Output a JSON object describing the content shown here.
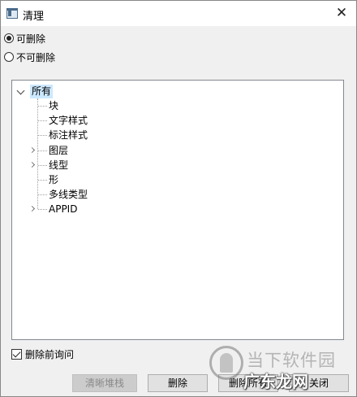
{
  "window": {
    "title": "清理",
    "close_glyph": "✕"
  },
  "options": {
    "purgeable": "可删除",
    "non_purgeable": "不可删除",
    "selected": "purgeable"
  },
  "tree": {
    "root": "所有",
    "items": [
      {
        "label": "块",
        "expandable": false
      },
      {
        "label": "文字样式",
        "expandable": false
      },
      {
        "label": "标注样式",
        "expandable": false
      },
      {
        "label": "图层",
        "expandable": true
      },
      {
        "label": "线型",
        "expandable": true
      },
      {
        "label": "形",
        "expandable": false
      },
      {
        "label": "多线类型",
        "expandable": false
      },
      {
        "label": "APPID",
        "expandable": true
      }
    ]
  },
  "confirm_checkbox": {
    "label": "删除前询问",
    "checked": true
  },
  "buttons": {
    "clean_stack": "清晰堆栈",
    "delete": "删除",
    "delete_all": "删除所有",
    "close": "关闭"
  },
  "watermark": {
    "line1": "当下软件园",
    "line2": "广东龙网"
  },
  "icons": {
    "app": "window-app-icon",
    "close": "close-icon",
    "expand": "chevron-down-icon",
    "collapsed": "chevron-right-icon"
  }
}
